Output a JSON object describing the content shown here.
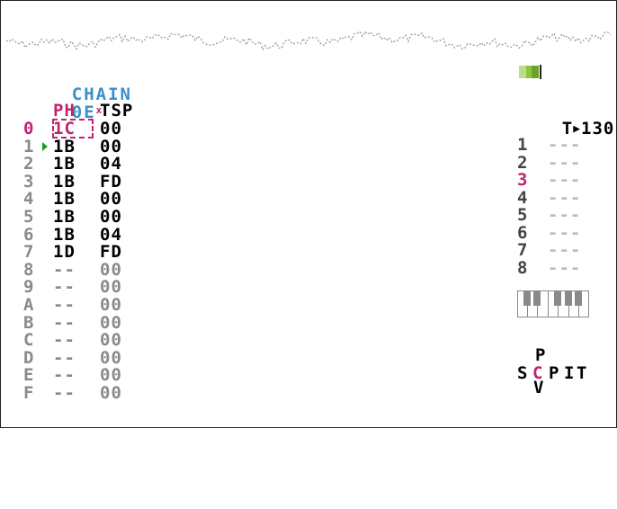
{
  "title": "CHAIN",
  "chain_id": "0E",
  "chain_suffix": "x",
  "columns": {
    "phrase": "PH",
    "transpose": "TSP"
  },
  "rows": [
    {
      "index": "0",
      "phrase": "1C",
      "transpose": "00"
    },
    {
      "index": "1",
      "phrase": "1B",
      "transpose": "00"
    },
    {
      "index": "2",
      "phrase": "1B",
      "transpose": "04"
    },
    {
      "index": "3",
      "phrase": "1B",
      "transpose": "FD"
    },
    {
      "index": "4",
      "phrase": "1B",
      "transpose": "00"
    },
    {
      "index": "5",
      "phrase": "1B",
      "transpose": "00"
    },
    {
      "index": "6",
      "phrase": "1B",
      "transpose": "04"
    },
    {
      "index": "7",
      "phrase": "1D",
      "transpose": "FD"
    },
    {
      "index": "8",
      "phrase": "--",
      "transpose": "00"
    },
    {
      "index": "9",
      "phrase": "--",
      "transpose": "00"
    },
    {
      "index": "A",
      "phrase": "--",
      "transpose": "00"
    },
    {
      "index": "B",
      "phrase": "--",
      "transpose": "00"
    },
    {
      "index": "C",
      "phrase": "--",
      "transpose": "00"
    },
    {
      "index": "D",
      "phrase": "--",
      "transpose": "00"
    },
    {
      "index": "E",
      "phrase": "--",
      "transpose": "00"
    },
    {
      "index": "F",
      "phrase": "--",
      "transpose": "00"
    }
  ],
  "selected_row": 0,
  "playing_row": 1,
  "tempo": {
    "label": "T",
    "value": "130"
  },
  "tracks": [
    {
      "number": "1",
      "value": "---"
    },
    {
      "number": "2",
      "value": "---"
    },
    {
      "number": "3",
      "value": "---"
    },
    {
      "number": "4",
      "value": "---"
    },
    {
      "number": "5",
      "value": "---"
    },
    {
      "number": "6",
      "value": "---"
    },
    {
      "number": "7",
      "value": "---"
    },
    {
      "number": "8",
      "value": "---"
    }
  ],
  "active_track": 3,
  "nav": {
    "top": "P",
    "left": "S",
    "current": "C",
    "right1": "P",
    "right2": "I",
    "right3": "T",
    "bottom": "V"
  },
  "colors": {
    "accent": "#c2236c",
    "title": "#3a8fc9",
    "active_text": "#000000",
    "inactive_text": "#8a8a8a",
    "play_marker": "#1c9a2a",
    "battery": "#8cc63f"
  },
  "icons": {
    "battery": "battery-icon",
    "piano": "piano-keyboard-icon",
    "play": "play-marker-icon"
  }
}
